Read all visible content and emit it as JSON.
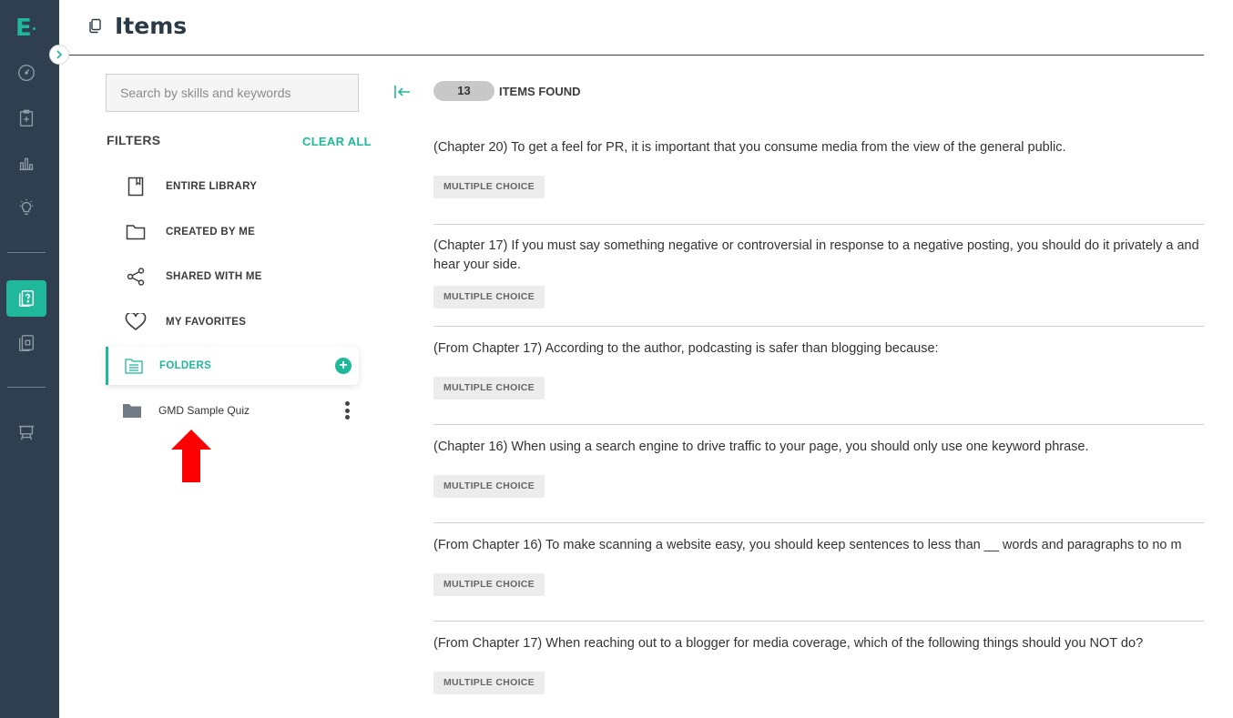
{
  "app": {
    "logo": "E"
  },
  "header": {
    "title": "Items"
  },
  "search": {
    "placeholder": "Search by skills and keywords"
  },
  "filters": {
    "label": "FILTERS",
    "clear_all": "CLEAR ALL",
    "items": [
      {
        "label": "ENTIRE LIBRARY",
        "icon": "bookmark-book-icon"
      },
      {
        "label": "CREATED BY ME",
        "icon": "folder-outline-icon"
      },
      {
        "label": "SHARED WITH ME",
        "icon": "share-icon"
      },
      {
        "label": "MY FAVORITES",
        "icon": "heart-icon"
      }
    ],
    "folders_label": "FOLDERS",
    "folder_entries": [
      {
        "name": "GMD Sample Quiz"
      }
    ]
  },
  "results": {
    "count": "13",
    "count_label": "ITEMS FOUND",
    "items": [
      {
        "question": "(Chapter 20) To get a feel for PR, it is important that you consume media from the view of the general public.",
        "type": "MULTIPLE CHOICE"
      },
      {
        "question": "(Chapter 17) If you must say something negative or controversial in response to a negative posting, you should do it privately a and hear your side.",
        "type": "MULTIPLE CHOICE"
      },
      {
        "question": "(From Chapter 17) According to the author, podcasting is safer than blogging because:",
        "type": "MULTIPLE CHOICE"
      },
      {
        "question": "(Chapter 16) When using a search engine to drive traffic to your page, you should only use one keyword phrase.",
        "type": "MULTIPLE CHOICE"
      },
      {
        "question": "(From Chapter 16) To make scanning a website easy, you should keep sentences to less than __ words and paragraphs to no m",
        "type": "MULTIPLE CHOICE"
      },
      {
        "question": "(From Chapter 17) When reaching out to a blogger for media coverage, which of the following things should you NOT do?",
        "type": "MULTIPLE CHOICE"
      }
    ]
  },
  "colors": {
    "accent": "#1fb89a",
    "rail": "#2f3f4f",
    "annotation_arrow": "#ff0000"
  }
}
